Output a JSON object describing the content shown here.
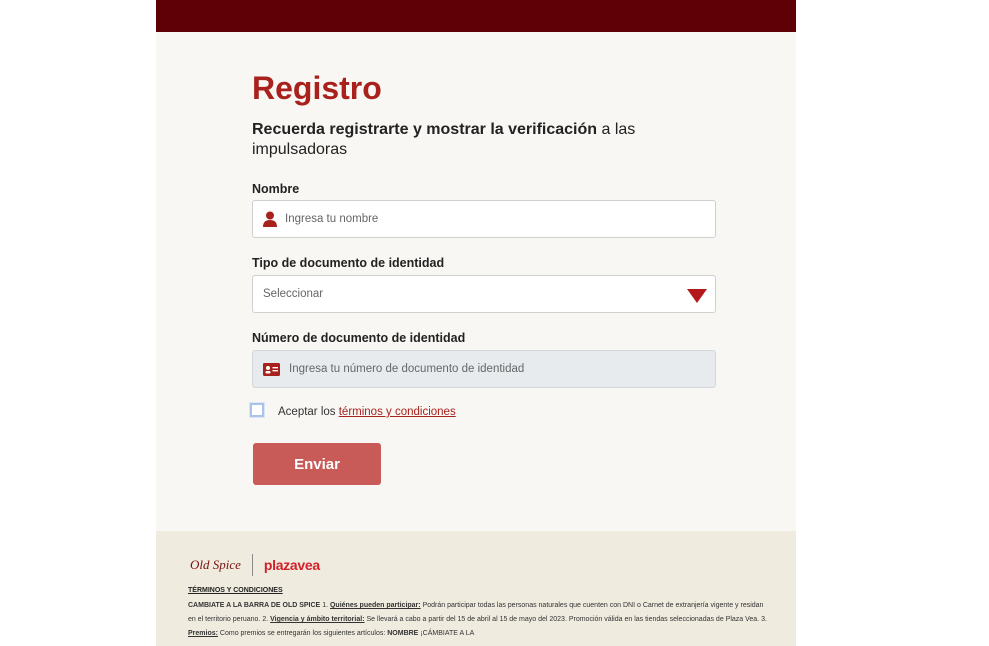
{
  "header": {
    "title": "Registro"
  },
  "subtitle": {
    "bold": "Recuerda registrarte y mostrar la verificación",
    "rest": "a las impulsadoras"
  },
  "form": {
    "name": {
      "label": "Nombre",
      "placeholder": "Ingresa tu nombre"
    },
    "doc_type": {
      "label": "Tipo de documento de identidad",
      "selected": "Seleccionar"
    },
    "doc_number": {
      "label": "Número de documento de identidad",
      "placeholder": "Ingresa tu número de documento de identidad"
    },
    "terms_check": {
      "prefix": "Aceptar los",
      "link": "términos y condiciones"
    },
    "submit_label": "Enviar"
  },
  "footer": {
    "logo_oldspice": "Old Spice",
    "logo_plazavea_a": "plaza",
    "logo_plazavea_b": "vea",
    "terms_heading": "TÉRMINOS Y CONDICIONES",
    "t1": "CAMBIATE A LA BARRA DE OLD SPICE",
    "t2": "1.",
    "t3": "Quiénes pueden participar:",
    "t4": "Podrán participar todas las personas naturales que cuenten con DNI o Carnet de extranjería vigente y residan en el territorio peruano. 2.",
    "t5": "Vigencia y ámbito territorial:",
    "t6": "Se llevará a cabo a partir del 15 de abril al 15 de mayo del 2023. Promoción válida en las tiendas seleccionadas de Plaza Vea. 3.",
    "t7": "Premios:",
    "t8": "Como premios se entregarán los siguientes artículos:",
    "t9": "NOMBRE",
    "t10": "¡CÁMBIATE A LA"
  },
  "colors": {
    "topbar": "#5e0005",
    "accent": "#a8211c",
    "button": "#c85a58",
    "footer_bg": "#efebdf"
  },
  "icons": {
    "name_field": "user-icon",
    "doc_field": "id-card-icon",
    "select": "caret-down-icon"
  }
}
